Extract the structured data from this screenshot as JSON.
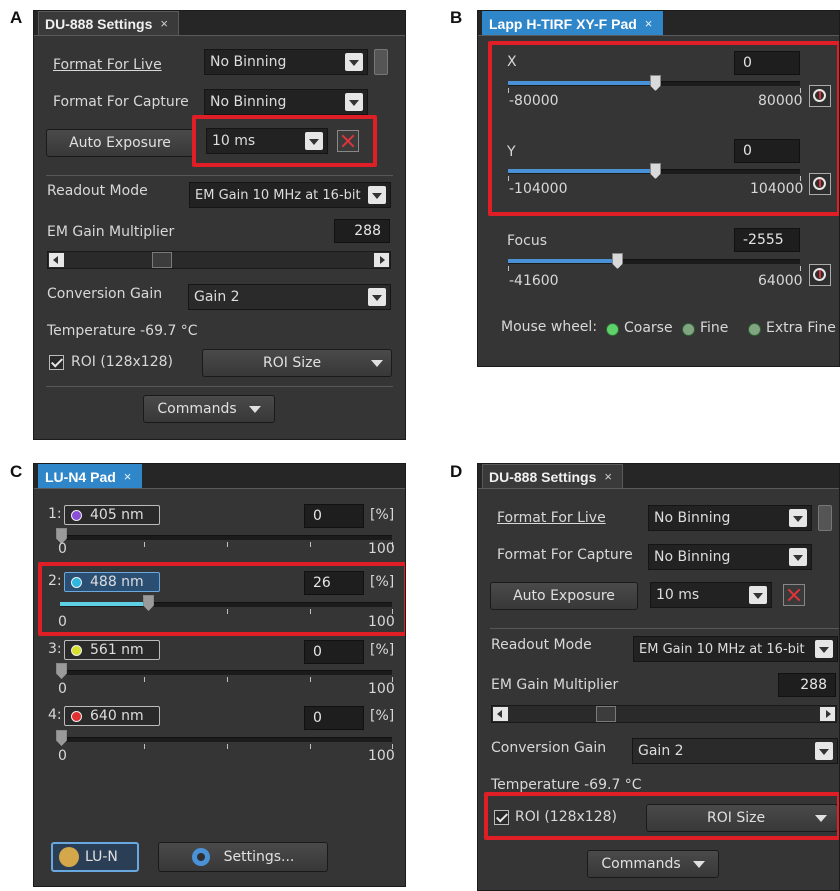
{
  "labels": {
    "A": "A",
    "B": "B",
    "C": "C",
    "D": "D"
  },
  "panelA": {
    "tab_title": "DU-888 Settings",
    "tab_close": "×",
    "format_live_label": "Format For Live",
    "format_live_value": "No Binning",
    "format_capture_label": "Format For Capture",
    "format_capture_value": "No Binning",
    "auto_exposure_label": "Auto Exposure",
    "exposure_value": "10 ms",
    "readout_label": "Readout Mode",
    "readout_value": "EM Gain 10 MHz at 16-bit",
    "em_gain_label": "EM Gain Multiplier",
    "em_gain_value": "288",
    "conversion_label": "Conversion Gain",
    "conversion_value": "Gain 2",
    "temperature": "Temperature -69.7 °C",
    "roi_label": "ROI (128x128)",
    "roi_size": "ROI Size",
    "commands": "Commands"
  },
  "panelB": {
    "tab_title": "Lapp H-TIRF XY-F Pad",
    "tab_close": "×",
    "x_label": "X",
    "x_value": "0",
    "x_min": "-80000",
    "x_max": "80000",
    "y_label": "Y",
    "y_value": "0",
    "y_min": "-104000",
    "y_max": "104000",
    "focus_label": "Focus",
    "focus_value": "-2555",
    "focus_min": "-41600",
    "focus_max": "64000",
    "mouse_wheel_label": "Mouse wheel:",
    "wheel_options": [
      "Coarse",
      "Fine",
      "Extra Fine"
    ]
  },
  "panelC": {
    "tab_title": "LU-N4 Pad",
    "tab_close": "×",
    "unit": "[%]",
    "scale_min": "0",
    "scale_max": "100",
    "lasers": [
      {
        "index": "1:",
        "name": "405 nm",
        "value": "0",
        "color": "#8a4fd6"
      },
      {
        "index": "2:",
        "name": "488 nm",
        "value": "26",
        "color": "#2fb6e0"
      },
      {
        "index": "3:",
        "name": "561 nm",
        "value": "0",
        "color": "#d6e02f"
      },
      {
        "index": "4:",
        "name": "640 nm",
        "value": "0",
        "color": "#e0302f"
      }
    ],
    "lun_button": "LU-N",
    "settings_button": "Settings..."
  },
  "panelD": {
    "tab_title": "DU-888 Settings",
    "tab_close": "×",
    "format_live_label": "Format For Live",
    "format_live_value": "No Binning",
    "format_capture_label": "Format For Capture",
    "format_capture_value": "No Binning",
    "auto_exposure_label": "Auto Exposure",
    "exposure_value": "10 ms",
    "readout_label": "Readout Mode",
    "readout_value": "EM Gain 10 MHz at 16-bit",
    "em_gain_label": "EM Gain Multiplier",
    "em_gain_value": "288",
    "conversion_label": "Conversion Gain",
    "conversion_value": "Gain 2",
    "temperature": "Temperature -69.7 °C",
    "roi_label": "ROI (128x128)",
    "roi_size": "ROI Size",
    "commands": "Commands"
  },
  "colors": {
    "highlight_box": "#e01e26",
    "active_tab": "#2f86c9",
    "slider_fill": "#4a92d8"
  }
}
